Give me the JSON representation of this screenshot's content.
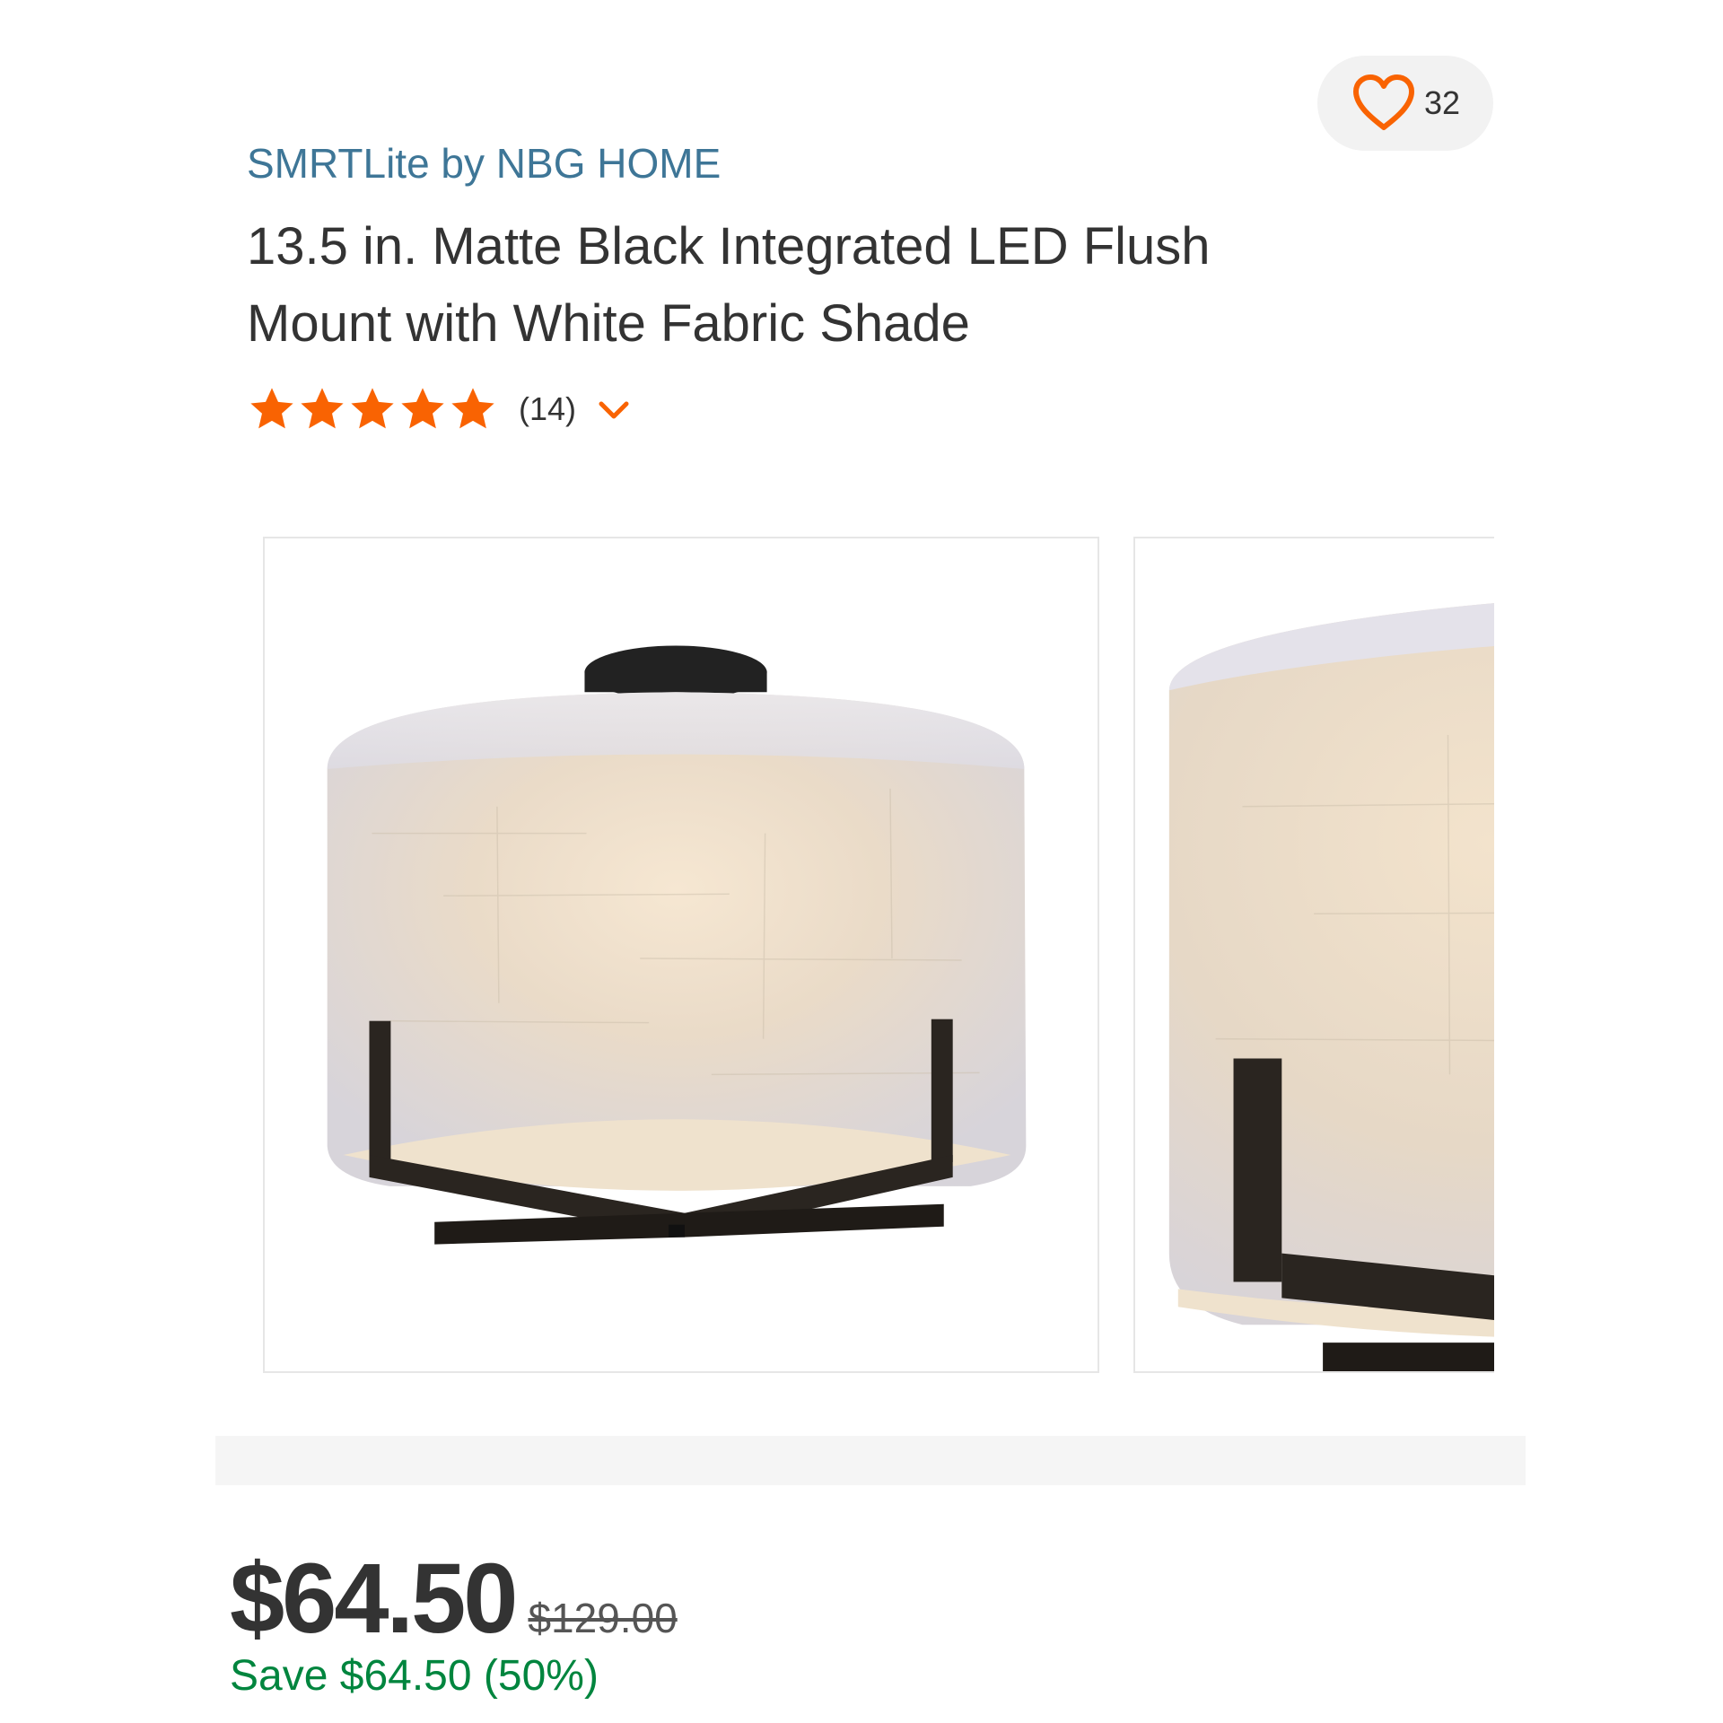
{
  "favorite": {
    "count": "32",
    "icon": "heart-outline-icon",
    "color": "#f96302"
  },
  "product": {
    "brand": "SMRTLite by NBG HOME",
    "title": "13.5 in. Matte Black Integrated LED Flush Mount with White Fabric Shade"
  },
  "rating": {
    "stars": 5,
    "max": 5,
    "reviews_label": "(14)",
    "star_color": "#f96302"
  },
  "gallery": {
    "images": [
      {
        "alt": "flush mount light front view"
      },
      {
        "alt": "flush mount light close-up view"
      }
    ]
  },
  "pricing": {
    "price": "$64.50",
    "was_price": "$129.00",
    "savings": "Save $64.50 (50%)",
    "savings_color": "#00853e"
  }
}
